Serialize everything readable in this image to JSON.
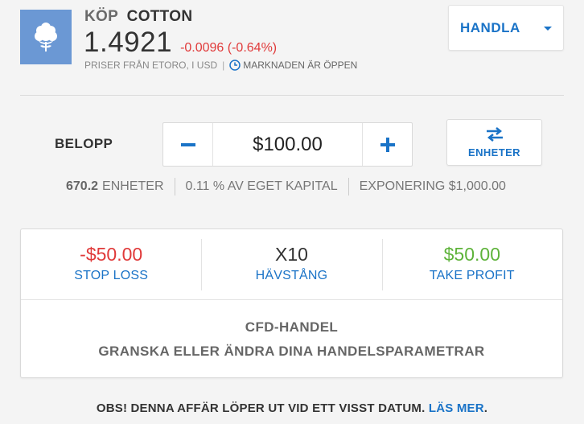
{
  "header": {
    "action": "KÖP",
    "instrument": "COTTON",
    "price": "1.4921",
    "change": "-0.0096 (-0.64%)",
    "source": "PRISER FRÅN ETORO, I USD",
    "separator": "|",
    "market_status": "MARKNADEN ÄR ÖPPEN",
    "logo_icon": "cotton-plant-icon"
  },
  "trade_button": {
    "label": "HANDLA"
  },
  "amount": {
    "label": "BELOPP",
    "value": "$100.00",
    "units_button_label": "ENHETER"
  },
  "info": {
    "units_value": "670.2",
    "units_label": "ENHETER",
    "equity": "0.11 % AV EGET KAPITAL",
    "exposure": "EXPONERING $1,000.00"
  },
  "params": {
    "stop_loss": {
      "value": "-$50.00",
      "label": "STOP LOSS"
    },
    "leverage": {
      "value": "X10",
      "label": "HÄVSTÅNG"
    },
    "take_profit": {
      "value": "$50.00",
      "label": "TAKE PROFIT"
    },
    "summary_title": "CFD-HANDEL",
    "summary_subtitle": "GRANSKA ELLER ÄNDRA DINA HANDELSPARAMETRAR"
  },
  "notice": {
    "text": "OBS! DENNA AFFÄR LÖPER UT VID ETT VISST DATUM. ",
    "link": "LÄS MER",
    "suffix": "."
  },
  "colors": {
    "accent": "#1a73c7",
    "negative": "#e03a3a",
    "positive": "#5eb33a",
    "logo_bg": "#6b98d4"
  }
}
